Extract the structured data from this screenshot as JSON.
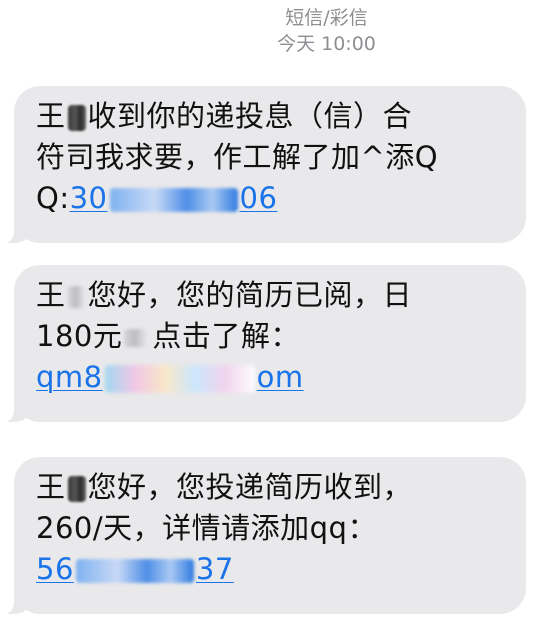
{
  "header": {
    "title": "短信/彩信",
    "timestamp": "今天 10:00"
  },
  "messages": [
    {
      "lines": [
        {
          "prefix": "王",
          "suffix": "收到你的递投息（信）合"
        },
        {
          "text": "符司我求要，作工解了加^添Q"
        },
        {
          "link_prefix": "Q:",
          "link_a": "30",
          "link_b": "06"
        }
      ]
    },
    {
      "lines": [
        {
          "prefix": "王",
          "suffix": "您好，您的简历已阅，日"
        },
        {
          "text_a": "180元",
          "text_b": "点击了解："
        },
        {
          "link_a": "qm8",
          "link_b": "om"
        }
      ]
    },
    {
      "lines": [
        {
          "prefix": "王",
          "suffix": "您好，您投递简历收到，"
        },
        {
          "text": "260/天，详情请添加qq："
        },
        {
          "link_a": "56",
          "link_b": "37"
        }
      ]
    }
  ]
}
